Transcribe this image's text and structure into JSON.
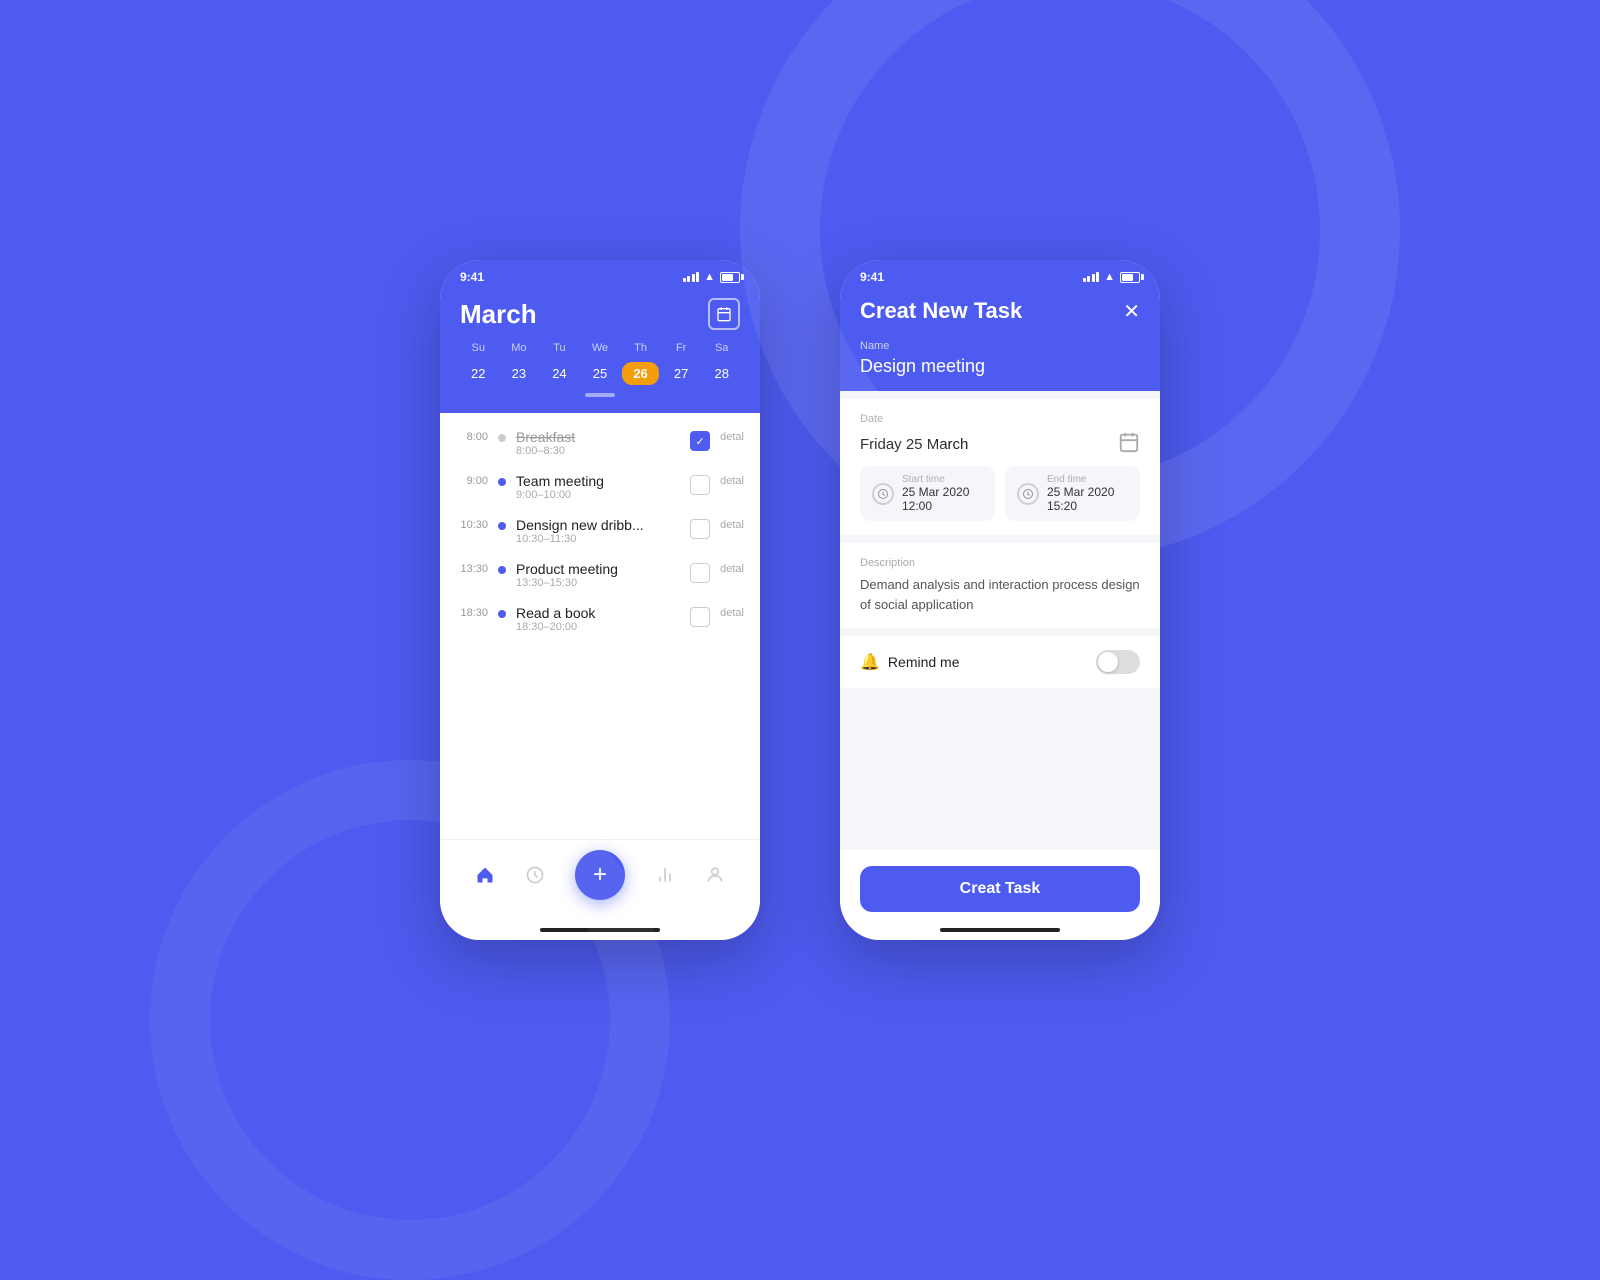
{
  "background": {
    "color": "#4D5BF0"
  },
  "phone1": {
    "status_time": "9:41",
    "header": {
      "month": "March",
      "calendar_icon": "📅"
    },
    "calendar": {
      "days_header": [
        "Su",
        "Mo",
        "Tu",
        "We",
        "Th",
        "Fr",
        "Sa"
      ],
      "days": [
        "22",
        "23",
        "24",
        "25",
        "26",
        "27",
        "28"
      ],
      "active_day": "26",
      "active_day_index": 4
    },
    "tasks": [
      {
        "time": "8:00",
        "name": "Breakfast",
        "range": "8:00–8:30",
        "dot": "gray",
        "checked": true,
        "strikethrough": true
      },
      {
        "time": "9:00",
        "name": "Team meeting",
        "range": "9:00–10:00",
        "dot": "blue",
        "checked": false,
        "strikethrough": false
      },
      {
        "time": "10:30",
        "name": "Densign new dribb...",
        "range": "10:30–11:30",
        "dot": "blue",
        "checked": false,
        "strikethrough": false
      },
      {
        "time": "13:30",
        "name": "Product meeting",
        "range": "13:30–15:30",
        "dot": "blue",
        "checked": false,
        "strikethrough": false
      },
      {
        "time": "18:30",
        "name": "Read a book",
        "range": "18:30–20:00",
        "dot": "blue",
        "checked": false,
        "strikethrough": false
      }
    ],
    "detail_label": "detal",
    "nav": {
      "home": "🏠",
      "clock": "🕐",
      "chart": "📊",
      "user": "👤",
      "fab": "+"
    }
  },
  "phone2": {
    "status_time": "9:41",
    "title": "Creat New Task",
    "close_icon": "✕",
    "name_label": "Name",
    "name_value": "Design meeting",
    "date_label": "Date",
    "date_value": "Friday 25 March",
    "start_time_label": "Start time",
    "start_time_value": "25 Mar 2020  12:00",
    "end_time_label": "End time",
    "end_time_value": "25 Mar 2020  15:20",
    "description_label": "Description",
    "description_value": "Demand analysis and interaction process design of social application",
    "remind_label": "Remind me",
    "toggle_state": "off",
    "creat_button": "Creat Task"
  }
}
